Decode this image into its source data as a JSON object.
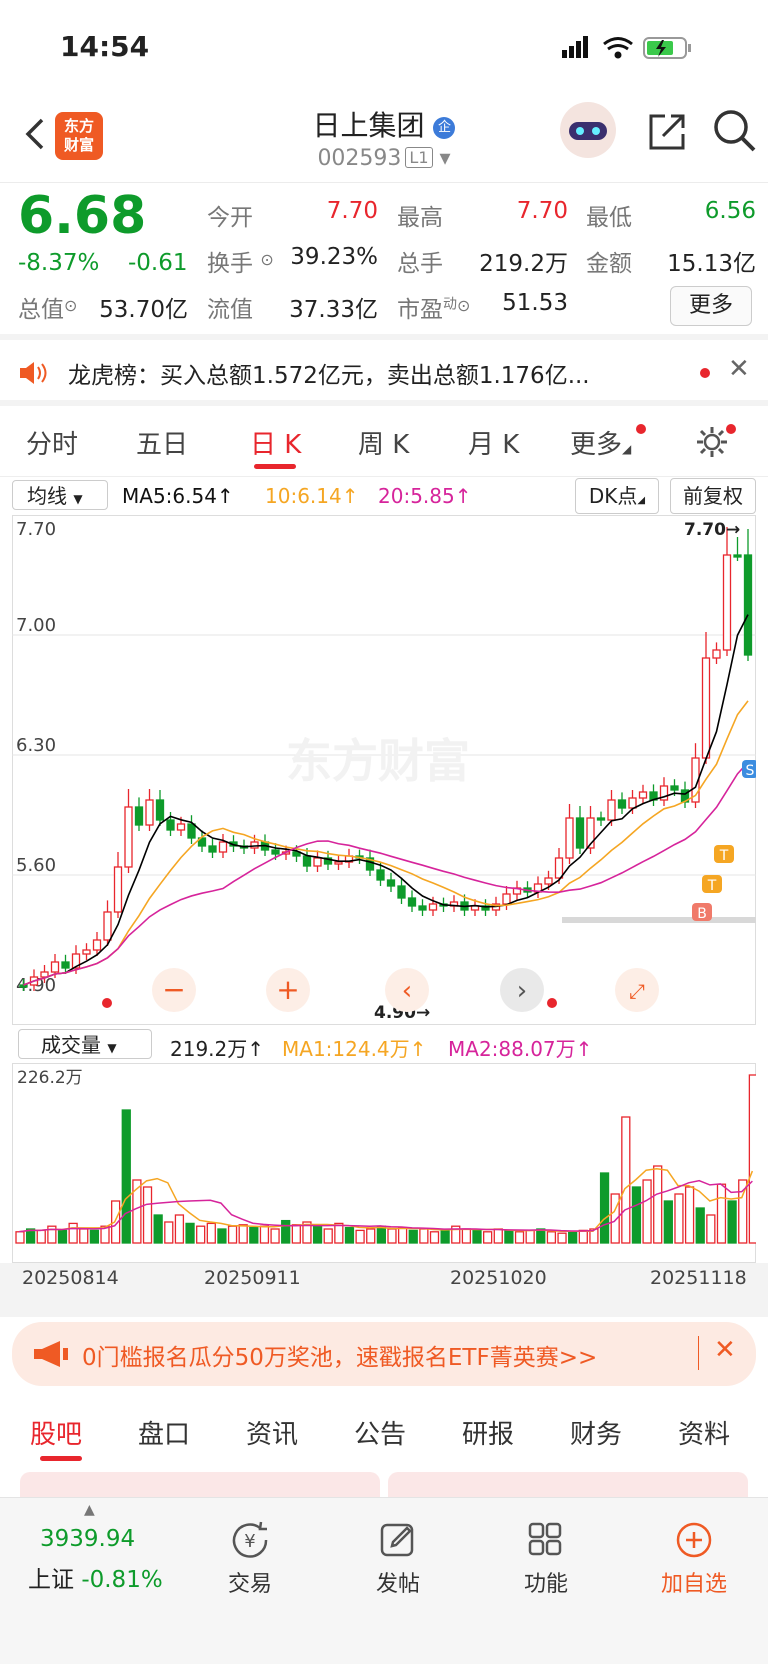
{
  "status": {
    "time": "14:54"
  },
  "header": {
    "logo_line1": "东方",
    "logo_line2": "财富",
    "name": "日上集团",
    "name_badge": "企",
    "code": "002593",
    "level": "L1"
  },
  "quote": {
    "price": "6.68",
    "change_pct": "-8.37%",
    "change": "-0.61",
    "labels": {
      "open": "今开",
      "high": "最高",
      "low": "最低",
      "turnover": "换手",
      "volume": "总手",
      "amount": "金额",
      "total_mv": "总值",
      "float_mv": "流值",
      "pe": "市盈",
      "pe_sup": "动"
    },
    "open": "7.70",
    "high": "7.70",
    "low": "6.56",
    "turnover": "39.23%",
    "volume": "219.2万",
    "amount": "15.13亿",
    "total_mv": "53.70亿",
    "float_mv": "37.33亿",
    "pe": "51.53",
    "more": "更多"
  },
  "news": {
    "text": "龙虎榜：买入总额1.572亿元，卖出总额1.176亿..."
  },
  "tabs": [
    "分时",
    "五日",
    "日 K",
    "周 K",
    "月 K",
    "更多"
  ],
  "indicator": {
    "type": "均线",
    "ma5": "MA5:6.54↑",
    "ma10": "10:6.14↑",
    "ma20": "20:5.85↑",
    "dk": "DK点",
    "adj": "前复权"
  },
  "kchart": {
    "y_labels": [
      "7.70",
      "7.00",
      "6.30",
      "5.60",
      "4.90"
    ],
    "high_label": "7.70→",
    "low_label": "4.90→",
    "watermark": "东方财富",
    "markers": [
      "S",
      "T",
      "T",
      "B"
    ]
  },
  "volume": {
    "type": "成交量",
    "vol": "219.2万↑",
    "ma1": "MA1:124.4万↑",
    "ma2": "MA2:88.07万↑",
    "max_label": "226.2万",
    "dates": [
      "20250814",
      "20250911",
      "20251020",
      "20251118"
    ]
  },
  "promo": {
    "text": "0门槛报名瓜分50万奖池，速戳报名ETF菁英赛>>"
  },
  "bottom_tabs": [
    "股吧",
    "盘口",
    "资讯",
    "公告",
    "研报",
    "财务",
    "资料"
  ],
  "bottom_nav": {
    "index_value": "3939.94",
    "index_name": "上证",
    "index_change": "-0.81%",
    "trade": "交易",
    "post": "发帖",
    "func": "功能",
    "add": "加自选"
  },
  "colors": {
    "up": "#e8262d",
    "down": "#0e9b2b",
    "accent": "#ef5a24",
    "ma5": "#000000",
    "ma10": "#f5a623",
    "ma20": "#d6249b"
  }
}
